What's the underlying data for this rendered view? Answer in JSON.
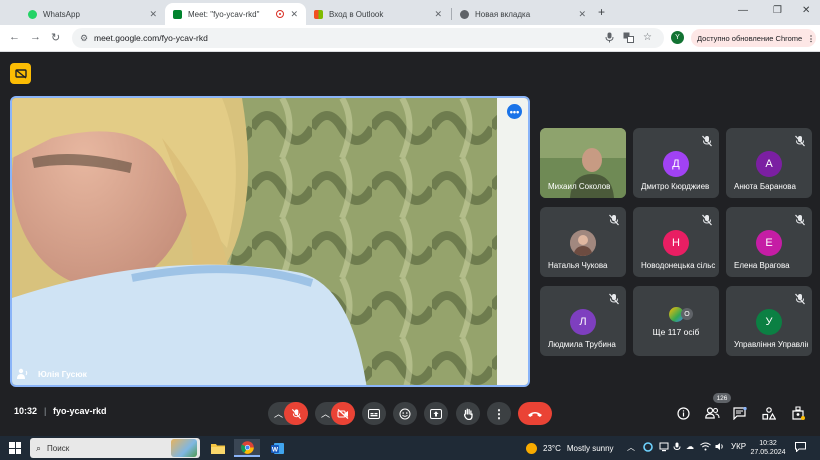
{
  "browser": {
    "tabs": [
      {
        "title": "WhatsApp",
        "favicon_color": "#25d366",
        "active": false
      },
      {
        "title": "Meet: \"fyo-ycav-rkd\"",
        "favicon_color": "#00832d",
        "active": true
      },
      {
        "title": "Вход в Outlook",
        "favicon_color": "#0078d4",
        "active": false
      },
      {
        "title": "Новая вкладка",
        "favicon_color": "#5f6368",
        "active": false
      }
    ],
    "url": "meet.google.com/fyo-ycav-rkd",
    "profile_initial": "Y",
    "update_label": "Доступно обновление Chrome"
  },
  "meeting": {
    "main_speaker": "Юлія Гусюк",
    "time": "10:32",
    "separator": "|",
    "code": "fyo-ycav-rkd",
    "participant_count": "126",
    "more_dots": "•••"
  },
  "participants": [
    {
      "name": "Михаил Соколов",
      "type": "video"
    },
    {
      "name": "Дмитро Кюрджиев",
      "initial": "Д",
      "color": "#a142f4",
      "type": "initial"
    },
    {
      "name": "Анюта Баранова",
      "initial": "А",
      "color": "#7b1fa2",
      "type": "initial"
    },
    {
      "name": "Наталья Чукова",
      "type": "photo"
    },
    {
      "name": "Новодонецька сільська",
      "initial": "Н",
      "color": "#e91e63",
      "type": "initial"
    },
    {
      "name": "Елена Врагова",
      "initial": "Е",
      "color": "#c51da5",
      "type": "initial"
    },
    {
      "name": "Людмила Трубина",
      "initial": "Л",
      "color": "#7e3fbf",
      "type": "initial"
    },
    {
      "label": "Ще 117 осіб",
      "count_badge": "О",
      "type": "more"
    },
    {
      "name": "Управління Управління",
      "initial": "У",
      "color": "#0b8043",
      "type": "initial"
    }
  ],
  "taskbar": {
    "search_placeholder": "Поиск",
    "temperature": "23°C",
    "weather_text": "Mostly sunny",
    "language": "УКР",
    "time": "10:32",
    "date": "27.05.2024"
  },
  "colors": {
    "meet_bg": "#202124",
    "accent": "#8ab4f8",
    "danger": "#ea4335"
  }
}
